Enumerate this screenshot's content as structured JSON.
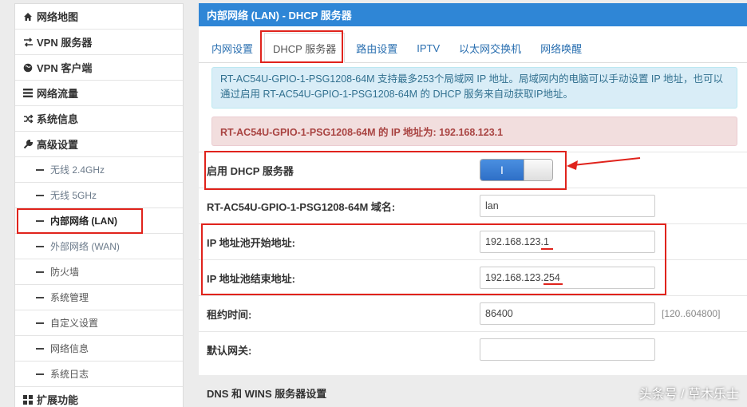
{
  "sidebar": {
    "items": [
      {
        "label": "网络地图",
        "icon": "home-icon"
      },
      {
        "label": "VPN 服务器",
        "icon": "exchange-icon"
      },
      {
        "label": "VPN 客户端",
        "icon": "globe-icon"
      },
      {
        "label": "网络流量",
        "icon": "list-icon"
      },
      {
        "label": "系统信息",
        "icon": "shuffle-icon"
      },
      {
        "label": "高级设置",
        "icon": "wrench-icon"
      }
    ],
    "subitems": [
      {
        "label": "无线 2.4GHz"
      },
      {
        "label": "无线 5GHz"
      },
      {
        "label": "内部网络 (LAN)"
      },
      {
        "label": "外部网络 (WAN)"
      },
      {
        "label": "防火墙"
      },
      {
        "label": "系统管理"
      },
      {
        "label": "自定义设置"
      },
      {
        "label": "网络信息"
      },
      {
        "label": "系统日志"
      }
    ],
    "bottom_item": {
      "label": "扩展功能",
      "icon": "grid-icon"
    }
  },
  "panel": {
    "title": "内部网络 (LAN) - DHCP 服务器",
    "tabs": [
      "内网设置",
      "DHCP 服务器",
      "路由设置",
      "IPTV",
      "以太网交换机",
      "网络唤醒"
    ],
    "info_text": "RT-AC54U-GPIO-1-PSG1208-64M 支持最多253个局域网 IP 地址。局域网内的电脑可以手动设置 IP 地址，也可以通过启用 RT-AC54U-GPIO-1-PSG1208-64M 的 DHCP 服务来自动获取IP地址。",
    "ip_notice": "RT-AC54U-GPIO-1-PSG1208-64M 的 IP 地址为: 192.168.123.1",
    "fields": {
      "dhcp_enable": {
        "label": "启用 DHCP 服务器",
        "toggle_text": "I"
      },
      "domain": {
        "label": "RT-AC54U-GPIO-1-PSG1208-64M 域名:",
        "value": "lan"
      },
      "pool_start": {
        "label": "IP 地址池开始地址:",
        "value": "192.168.123.1"
      },
      "pool_end": {
        "label": "IP 地址池结束地址:",
        "value": "192.168.123.254"
      },
      "lease": {
        "label": "租约时间:",
        "value": "86400",
        "hint": "[120..604800]"
      },
      "gateway": {
        "label": "默认网关:",
        "value": ""
      }
    },
    "section_title": "DNS 和 WINS 服务器设置"
  },
  "watermark": "头条号 / 草木乐士",
  "colors": {
    "header": "#2f86d6",
    "annotation": "#e0231c"
  }
}
